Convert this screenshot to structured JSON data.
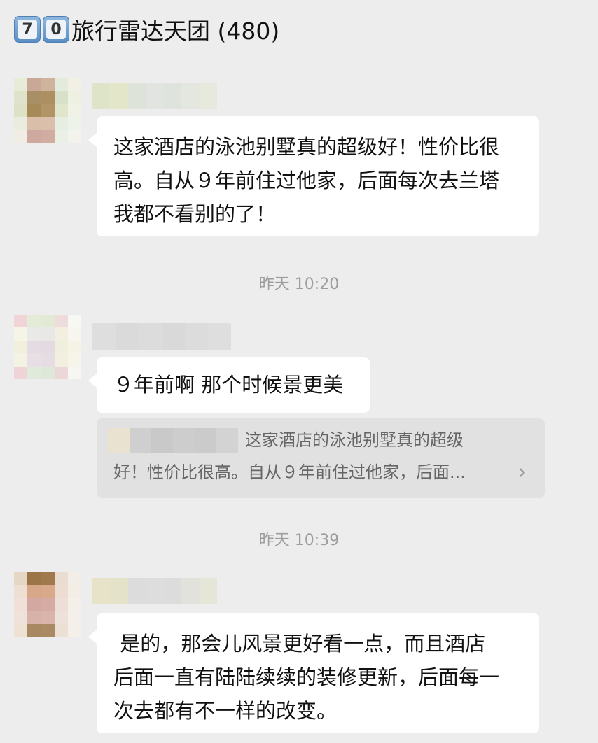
{
  "header": {
    "keycaps": [
      "7",
      "0"
    ],
    "group_name": "旅行雷达天团 (480)"
  },
  "messages": [
    {
      "lines": [
        "这家酒店的泳池别墅真的超级好！性价比很",
        "高。自从９年前住过他家，后面每次去兰塔",
        "我都不看别的了！"
      ]
    },
    {
      "lines": [
        "９年前啊 那个时候景更美"
      ],
      "quote": {
        "line1": "这家酒店的泳池别墅真的超级",
        "line2": "好！性价比很高。自从９年前住过他家，后面..."
      }
    },
    {
      "lines": [
        " 是的，那会儿风景更好看一点，而且酒店",
        "后面一直有陆陆续续的装修更新，后面每一",
        "次去都有不一样的改变。"
      ]
    }
  ],
  "timestamps": [
    "昨天 10:20",
    "昨天 10:39"
  ],
  "icons": {
    "quote_chevron": "chevron-right-icon"
  },
  "colors": {
    "bubble": "#ffffff",
    "background": "#ededed",
    "quote_bg": "#e1e1e1"
  }
}
